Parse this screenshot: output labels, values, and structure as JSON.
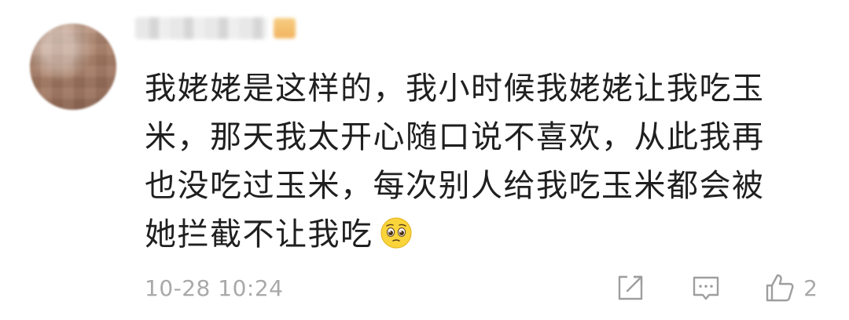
{
  "comment": {
    "username": "",
    "lines": [
      "我姥姥是这样的，我小时候我姥姥让我吃玉",
      "米，那天我太开心随口说不喜欢，从此我再",
      "也没吃过玉米，每次别人给我吃玉米都会被",
      "她拦截不让我吃"
    ],
    "emoji": "pleading-face-emoji",
    "timestamp": "10-28 10:24",
    "like_count": "2"
  },
  "icons": {
    "share": "share-icon",
    "reply": "reply-icon",
    "like": "thumbs-up-icon"
  },
  "colors": {
    "text": "#1f1f1f",
    "meta": "#a9a9a9",
    "icon": "#9e9e9e",
    "emoji_face": "#f9d43a"
  }
}
